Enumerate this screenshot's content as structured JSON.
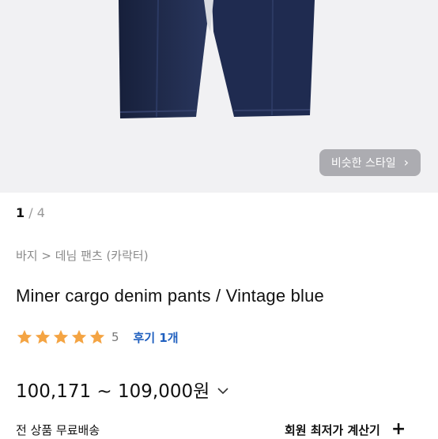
{
  "gallery": {
    "similar_style_label": "비슷한 스타일",
    "pager_current": "1",
    "pager_total": " / 4"
  },
  "breadcrumb": "바지 > 데님 팬츠 (카락터)",
  "product": {
    "title": "Miner cargo denim pants / Vintage blue",
    "rating": 5,
    "rating_text": "5",
    "review_label": "후기 1개",
    "price": "100,171 ~ 109,000원",
    "shipping": "전 상품 무료배송",
    "member_calc": "회원 최저가 계산기"
  },
  "colors": {
    "star": "#f4a443",
    "denim": "#1f2a4d",
    "link": "#1f5fbf"
  },
  "icons": {
    "star": "star-icon",
    "chevron_right": "chevron-right-icon",
    "chevron_down": "chevron-down-icon",
    "plus": "plus-icon"
  }
}
